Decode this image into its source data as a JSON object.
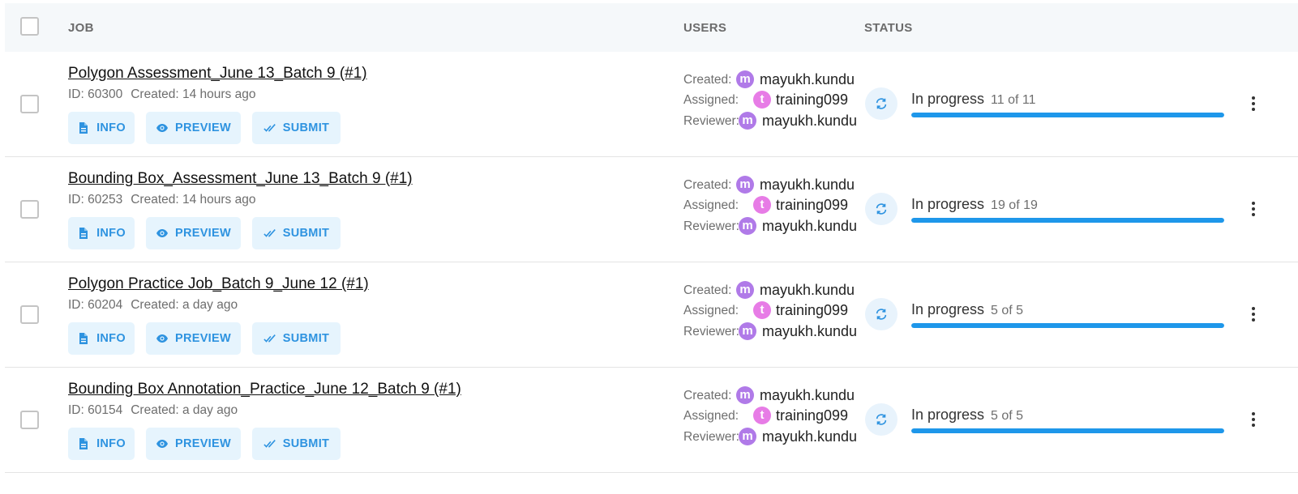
{
  "header": {
    "job": "JOB",
    "users": "USERS",
    "status": "STATUS"
  },
  "labels": {
    "created": "Created:",
    "assigned": "Assigned:",
    "reviewer": "Reviewer:",
    "info": "INFO",
    "preview": "PREVIEW",
    "submit": "SUBMIT"
  },
  "colors": {
    "accent": "#1e97ea",
    "avatar_m": "#b07ae8",
    "avatar_t": "#e77ce6"
  },
  "jobs": [
    {
      "title": "Polygon Assessment_June 13_Batch 9 (#1)",
      "id": "ID: 60300",
      "created": "Created: 14 hours ago",
      "created_by": {
        "initial": "m",
        "name": "mayukh.kundu"
      },
      "assigned_to": {
        "initial": "t",
        "name": "training099"
      },
      "reviewer": {
        "initial": "m",
        "name": "mayukh.kundu"
      },
      "status": "In progress",
      "count": "11 of 11",
      "progress": 1.0
    },
    {
      "title": "Bounding Box_Assessment_June 13_Batch 9 (#1)",
      "id": "ID: 60253",
      "created": "Created: 14 hours ago",
      "created_by": {
        "initial": "m",
        "name": "mayukh.kundu"
      },
      "assigned_to": {
        "initial": "t",
        "name": "training099"
      },
      "reviewer": {
        "initial": "m",
        "name": "mayukh.kundu"
      },
      "status": "In progress",
      "count": "19 of 19",
      "progress": 1.0
    },
    {
      "title": "Polygon Practice Job_Batch 9_June 12 (#1)",
      "id": "ID: 60204",
      "created": "Created: a day ago",
      "created_by": {
        "initial": "m",
        "name": "mayukh.kundu"
      },
      "assigned_to": {
        "initial": "t",
        "name": "training099"
      },
      "reviewer": {
        "initial": "m",
        "name": "mayukh.kundu"
      },
      "status": "In progress",
      "count": "5 of 5",
      "progress": 1.0
    },
    {
      "title": "Bounding Box Annotation_Practice_June 12_Batch 9 (#1)",
      "id": "ID: 60154",
      "created": "Created: a day ago",
      "created_by": {
        "initial": "m",
        "name": "mayukh.kundu"
      },
      "assigned_to": {
        "initial": "t",
        "name": "training099"
      },
      "reviewer": {
        "initial": "m",
        "name": "mayukh.kundu"
      },
      "status": "In progress",
      "count": "5 of 5",
      "progress": 1.0
    }
  ]
}
